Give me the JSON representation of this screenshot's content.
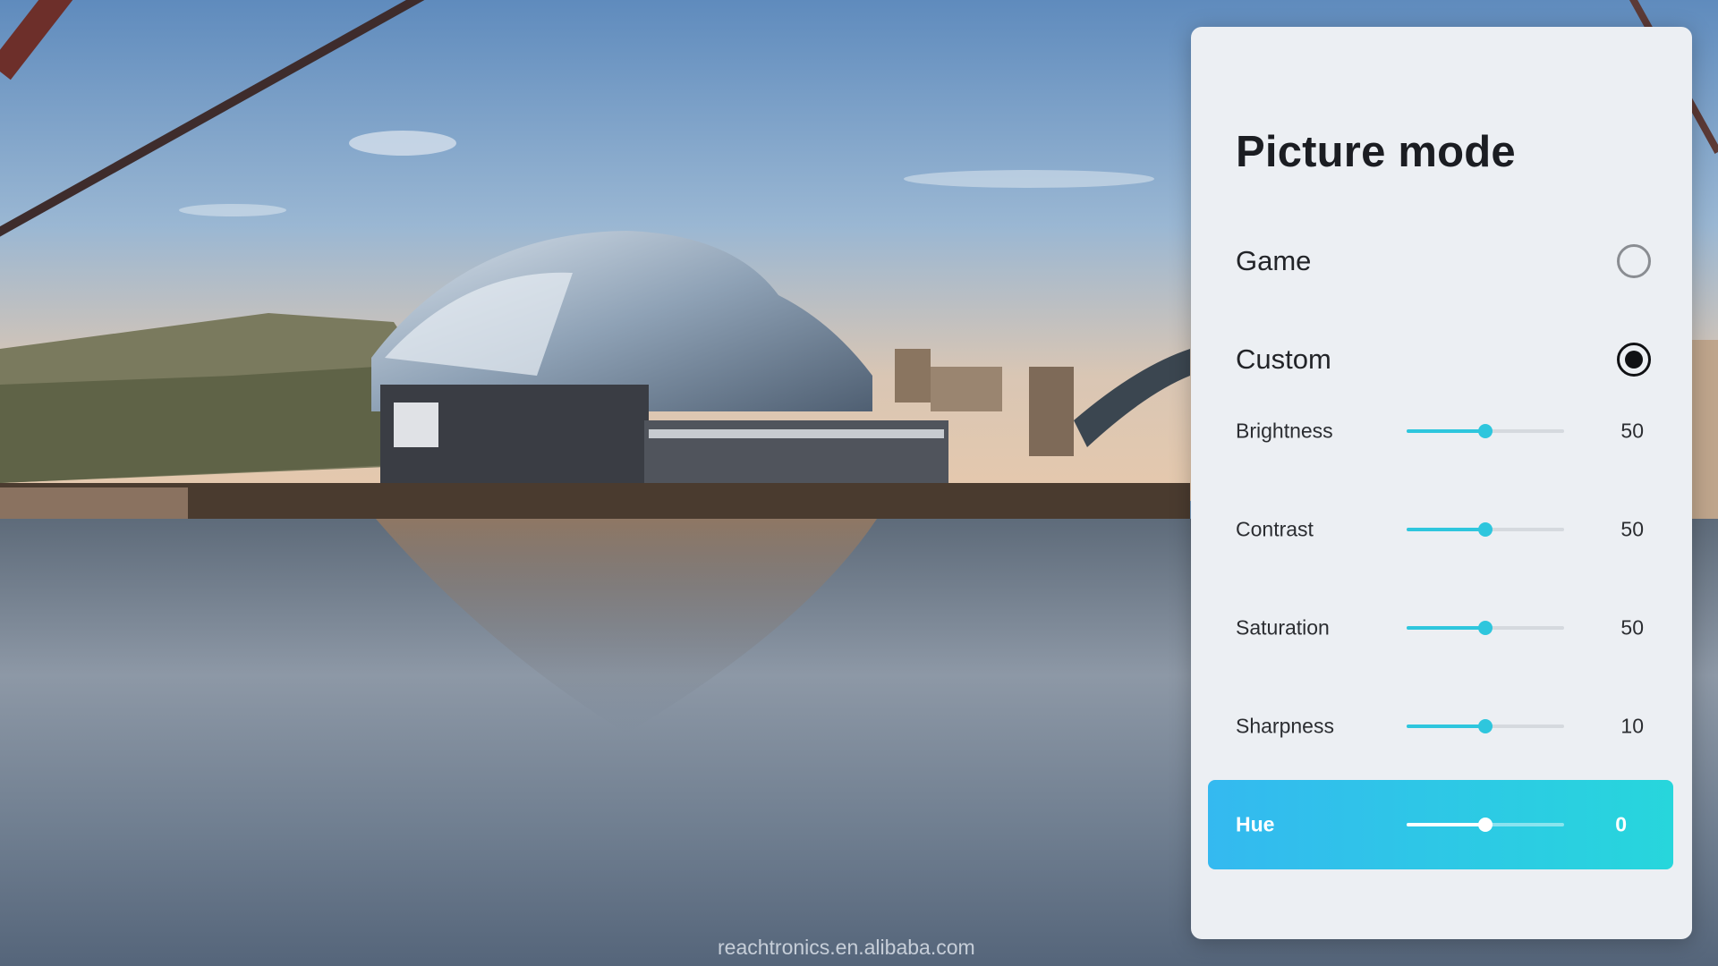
{
  "watermark": "reachtronics.en.alibaba.com",
  "panel": {
    "title": "Picture mode",
    "modes": [
      {
        "label": "Game",
        "selected": false
      },
      {
        "label": "Custom",
        "selected": true
      }
    ],
    "settings": [
      {
        "label": "Brightness",
        "value": "50",
        "slider_fraction": 0.5,
        "focused": false
      },
      {
        "label": "Contrast",
        "value": "50",
        "slider_fraction": 0.5,
        "focused": false
      },
      {
        "label": "Saturation",
        "value": "50",
        "slider_fraction": 0.5,
        "focused": false
      },
      {
        "label": "Sharpness",
        "value": "10",
        "slider_fraction": 0.5,
        "focused": false
      },
      {
        "label": "Hue",
        "value": "0",
        "slider_fraction": 0.5,
        "focused": true
      }
    ]
  },
  "colors": {
    "panel_bg": "#eceff3",
    "accent": "#2ec6dd",
    "focus_gradient_start": "#34b9f0",
    "focus_gradient_end": "#27d6dc"
  },
  "icons": {
    "radio_unchecked": "radio-unchecked-icon",
    "radio_checked": "radio-checked-icon"
  }
}
